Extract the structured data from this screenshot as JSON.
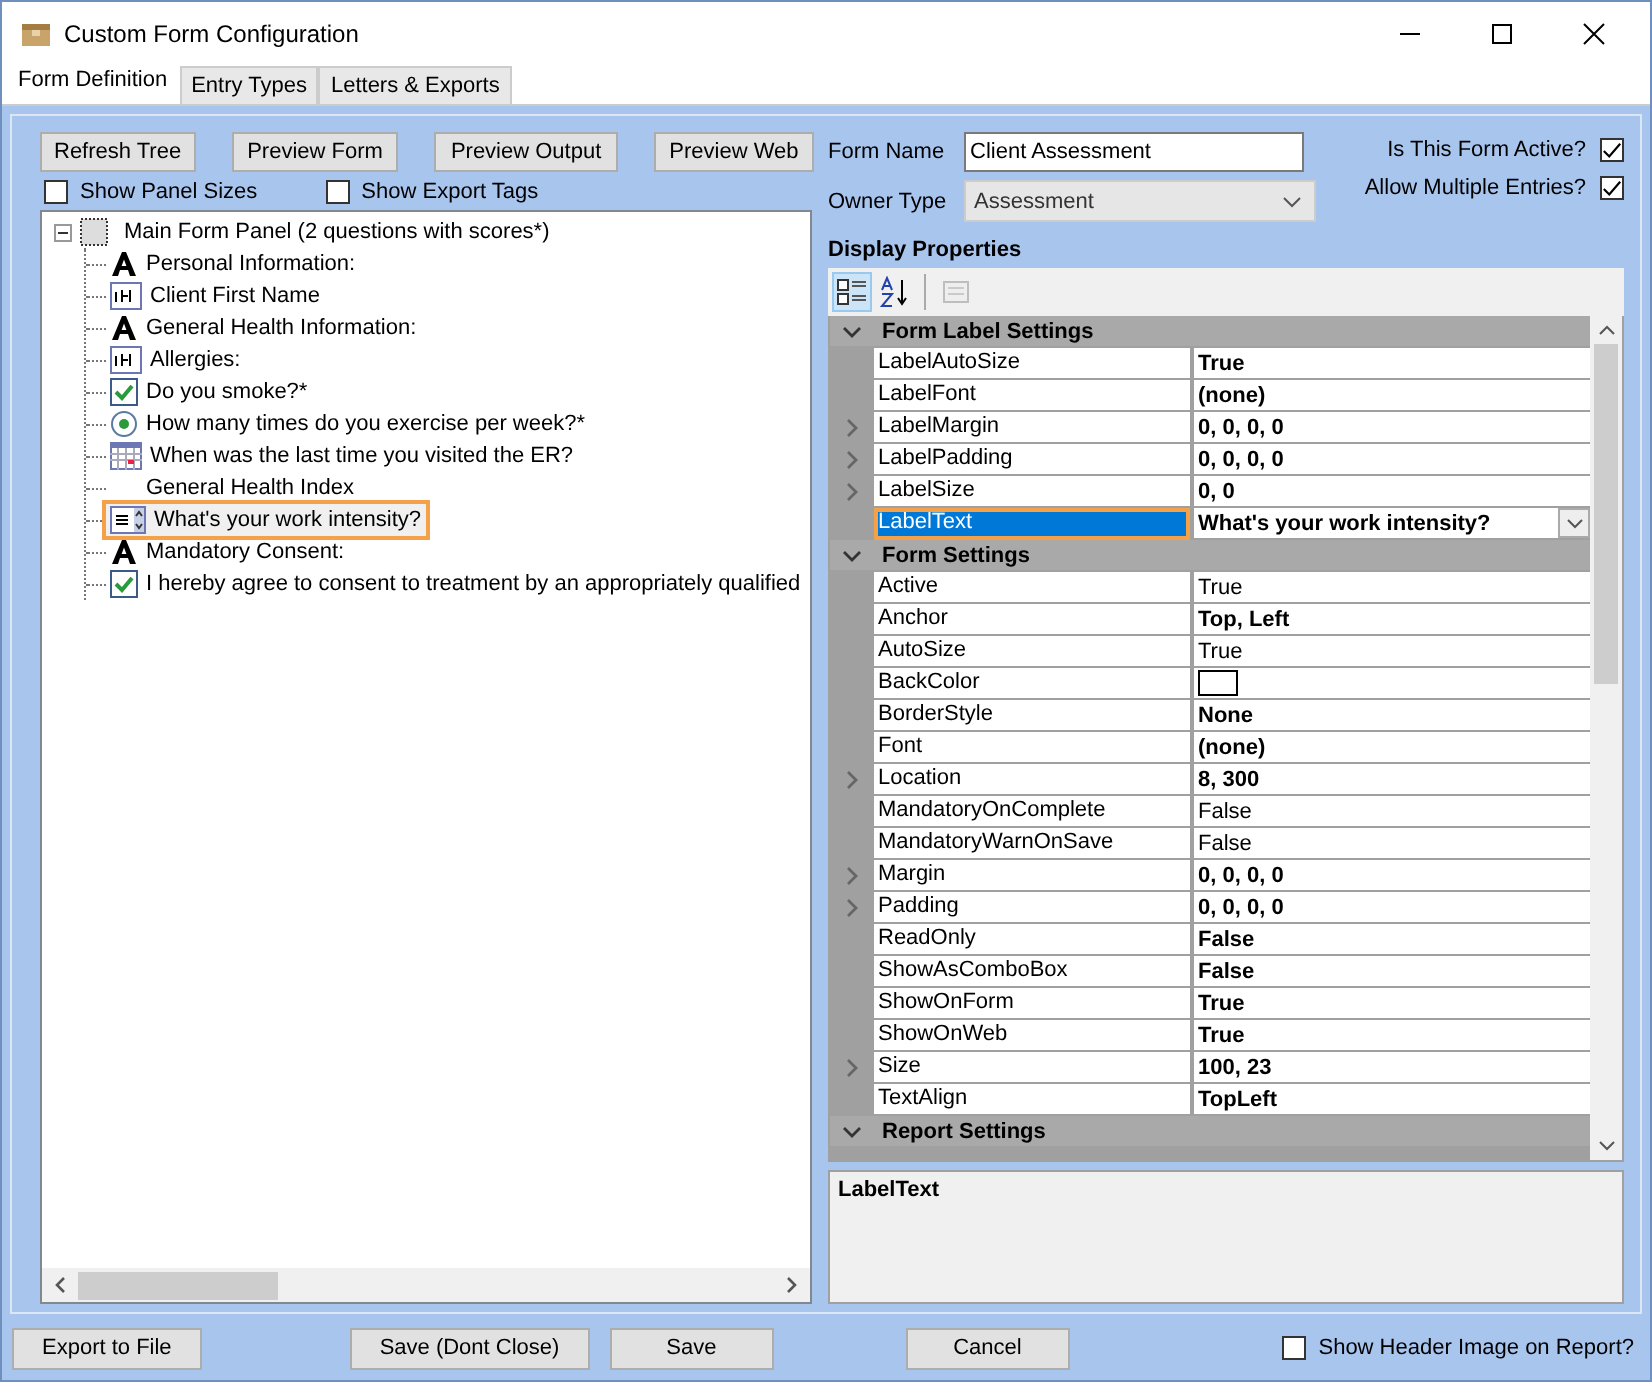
{
  "window": {
    "title": "Custom Form Configuration"
  },
  "tabs": [
    {
      "label": "Form Definition",
      "selected": true
    },
    {
      "label": "Entry Types",
      "selected": false
    },
    {
      "label": "Letters & Exports",
      "selected": false
    }
  ],
  "toolbar_buttons": [
    "Refresh Tree",
    "Preview Form",
    "Preview Output",
    "Preview Web"
  ],
  "options": [
    {
      "label": "Show Panel Sizes",
      "checked": false
    },
    {
      "label": "Show Export Tags",
      "checked": false
    }
  ],
  "tree": {
    "label": "Main Form Panel (2 questions with scores*)",
    "expanded": true,
    "children": [
      {
        "label": "Personal Information:",
        "kind": "label",
        "selected": false
      },
      {
        "label": "Client First Name",
        "kind": "textbox",
        "selected": false
      },
      {
        "label": "General Health Information:",
        "kind": "label",
        "selected": false
      },
      {
        "label": "Allergies:",
        "kind": "textbox",
        "selected": false
      },
      {
        "label": "Do you smoke?*",
        "kind": "checkbox",
        "selected": false
      },
      {
        "label": "How many times do you exercise per week?*",
        "kind": "radio",
        "selected": false
      },
      {
        "label": "When was the last time you visited the ER?",
        "kind": "date",
        "selected": false
      },
      {
        "label": "General Health Index",
        "kind": "none",
        "selected": false
      },
      {
        "label": "What's your work intensity?",
        "kind": "combo",
        "selected": true
      },
      {
        "label": "Mandatory Consent:",
        "kind": "label",
        "selected": false
      },
      {
        "label": "I hereby agree to consent to treatment by an appropriately qualified",
        "kind": "checkbox",
        "selected": false
      }
    ]
  },
  "form_name": {
    "label": "Form Name",
    "value": "Client Assessment"
  },
  "owner_type": {
    "label": "Owner Type",
    "value": "Assessment"
  },
  "flags": [
    {
      "label": "Is This Form Active?",
      "checked": true
    },
    {
      "label": "Allow Multiple Entries?",
      "checked": true
    }
  ],
  "display_properties": {
    "title": "Display Properties",
    "categorized": true,
    "categories": [
      {
        "name": "Form Label Settings",
        "expanded": true,
        "rows": [
          {
            "name": "LabelAutoSize",
            "value": "True",
            "modified": true,
            "expandable": false,
            "selected": false
          },
          {
            "name": "LabelFont",
            "value": "(none)",
            "modified": true,
            "expandable": false,
            "selected": false
          },
          {
            "name": "LabelMargin",
            "value": "0, 0, 0, 0",
            "modified": true,
            "expandable": true,
            "selected": false
          },
          {
            "name": "LabelPadding",
            "value": "0, 0, 0, 0",
            "modified": true,
            "expandable": true,
            "selected": false
          },
          {
            "name": "LabelSize",
            "value": "0, 0",
            "modified": true,
            "expandable": true,
            "selected": false
          },
          {
            "name": "LabelText",
            "value": "What's your work intensity?",
            "modified": true,
            "expandable": false,
            "selected": true
          }
        ]
      },
      {
        "name": "Form Settings",
        "expanded": true,
        "rows": [
          {
            "name": "Active",
            "value": "True",
            "modified": false,
            "expandable": false,
            "selected": false
          },
          {
            "name": "Anchor",
            "value": "Top, Left",
            "modified": true,
            "expandable": false,
            "selected": false
          },
          {
            "name": "AutoSize",
            "value": "True",
            "modified": false,
            "expandable": false,
            "selected": false
          },
          {
            "name": "BackColor",
            "kind": "swatch",
            "color": "#ffffff",
            "expandable": false,
            "selected": false
          },
          {
            "name": "BorderStyle",
            "value": "None",
            "modified": true,
            "expandable": false,
            "selected": false
          },
          {
            "name": "Font",
            "value": "(none)",
            "modified": true,
            "expandable": false,
            "selected": false
          },
          {
            "name": "Location",
            "value": "8, 300",
            "modified": true,
            "expandable": true,
            "selected": false
          },
          {
            "name": "MandatoryOnComplete",
            "value": "False",
            "modified": false,
            "expandable": false,
            "selected": false
          },
          {
            "name": "MandatoryWarnOnSave",
            "value": "False",
            "modified": false,
            "expandable": false,
            "selected": false
          },
          {
            "name": "Margin",
            "value": "0, 0, 0, 0",
            "modified": true,
            "expandable": true,
            "selected": false
          },
          {
            "name": "Padding",
            "value": "0, 0, 0, 0",
            "modified": true,
            "expandable": true,
            "selected": false
          },
          {
            "name": "ReadOnly",
            "value": "False",
            "modified": true,
            "expandable": false,
            "selected": false
          },
          {
            "name": "ShowAsComboBox",
            "value": "False",
            "modified": true,
            "expandable": false,
            "selected": false
          },
          {
            "name": "ShowOnForm",
            "value": "True",
            "modified": true,
            "expandable": false,
            "selected": false
          },
          {
            "name": "ShowOnWeb",
            "value": "True",
            "modified": true,
            "expandable": false,
            "selected": false
          },
          {
            "name": "Size",
            "value": "100, 23",
            "modified": true,
            "expandable": true,
            "selected": false
          },
          {
            "name": "TextAlign",
            "value": "TopLeft",
            "modified": true,
            "expandable": false,
            "selected": false
          }
        ]
      },
      {
        "name": "Report Settings",
        "expanded": true
      }
    ],
    "description": "LabelText"
  },
  "footer_buttons": [
    "Export to File",
    "Save (Dont Close)",
    "Save",
    "Cancel"
  ],
  "header_image": {
    "label": "Show Header Image on Report?",
    "checked": false
  }
}
